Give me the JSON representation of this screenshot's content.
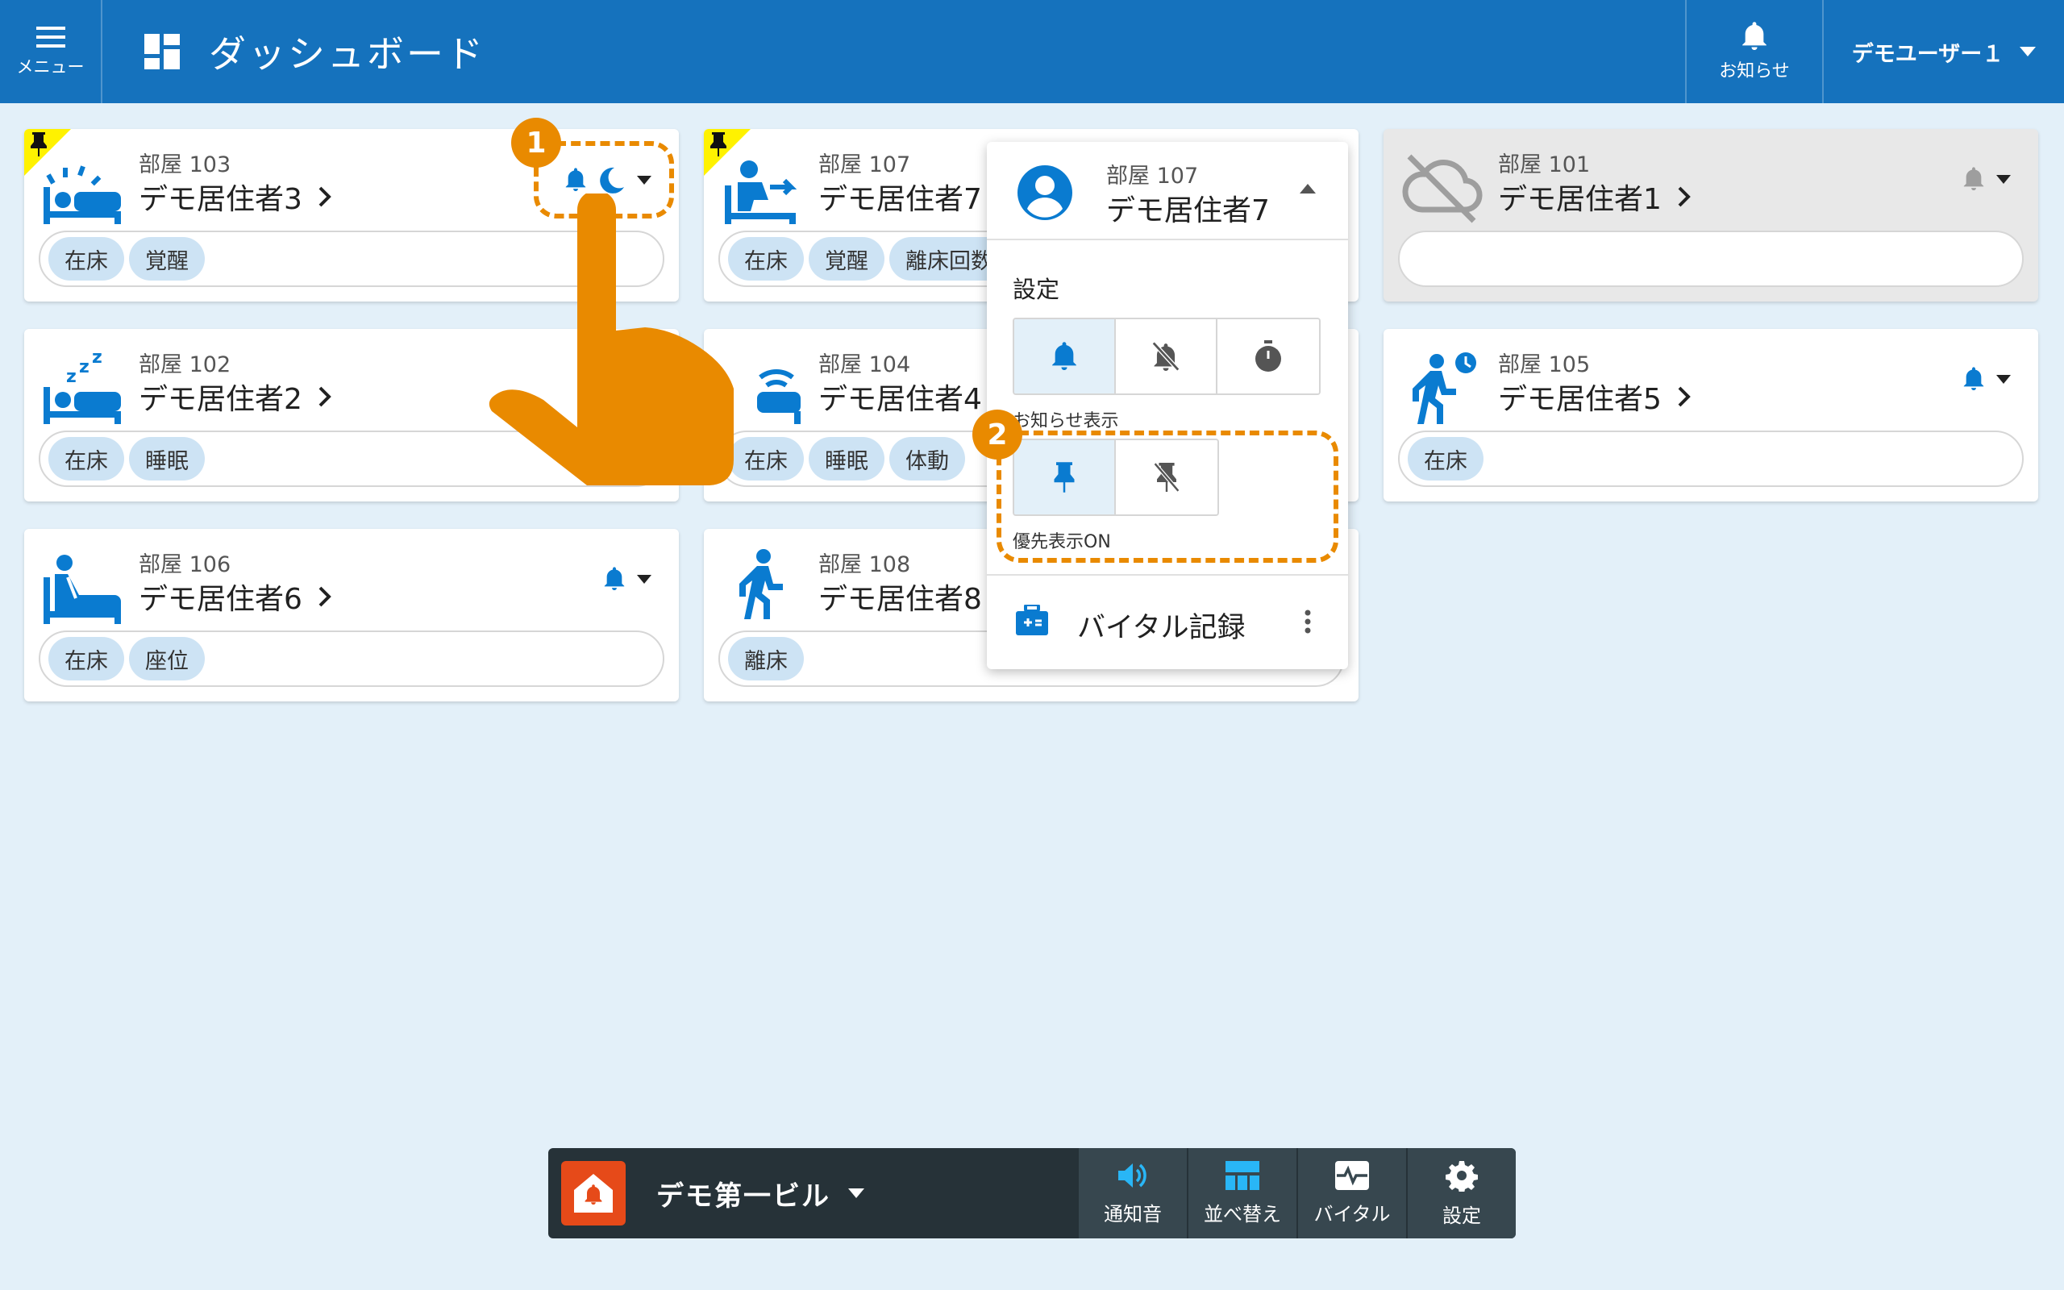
{
  "header": {
    "menu_label": "メニュー",
    "title": "ダッシュボード",
    "notice_label": "お知らせ",
    "user_name": "デモユーザー１"
  },
  "cards": [
    {
      "room": "部屋 103",
      "name": "デモ居住者3",
      "tags": [
        "在床",
        "覚醒"
      ],
      "pinned": true,
      "icon": "bed-awake-icon"
    },
    {
      "room": "部屋 107",
      "name": "デモ居住者7",
      "tags": [
        "在床",
        "覚醒",
        "離床回数"
      ],
      "pinned": true,
      "icon": "bed-getting-up-icon"
    },
    {
      "room": "部屋 101",
      "name": "デモ居住者1",
      "tags": [],
      "pinned": false,
      "icon": "cloud-off-icon"
    },
    {
      "room": "部屋 102",
      "name": "デモ居住者2",
      "tags": [
        "在床",
        "睡眠"
      ],
      "pinned": false,
      "icon": "bed-sleeping-icon"
    },
    {
      "room": "部屋 104",
      "name": "デモ居住者4",
      "tags": [
        "在床",
        "睡眠",
        "体動"
      ],
      "pinned": false,
      "icon": "bed-motion-icon"
    },
    {
      "room": "部屋 105",
      "name": "デモ居住者5",
      "tags": [
        "在床"
      ],
      "pinned": false,
      "icon": "walking-timer-icon"
    },
    {
      "room": "部屋 106",
      "name": "デモ居住者6",
      "tags": [
        "在床",
        "座位"
      ],
      "pinned": false,
      "icon": "bed-sitting-icon"
    },
    {
      "room": "部屋 108",
      "name": "デモ居住者8",
      "tags": [
        "離床"
      ],
      "pinned": false,
      "icon": "walking-icon"
    }
  ],
  "popup": {
    "room": "部屋 107",
    "name": "デモ居住者7",
    "settings_label": "設定",
    "notify_caption": "お知らせ表示",
    "priority_caption": "優先表示ON",
    "vital_label": "バイタル記録"
  },
  "annotations": {
    "badge1": "1",
    "badge2": "2"
  },
  "bottom_bar": {
    "building": "デモ第一ビル",
    "sound": "通知音",
    "sort": "並べ替え",
    "vital": "バイタル",
    "settings": "設定"
  },
  "colors": {
    "header": "#1572bd",
    "accent": "#0a7bd0",
    "annotation": "#e98a00",
    "pin": "#fff200",
    "bar": "#263238"
  }
}
